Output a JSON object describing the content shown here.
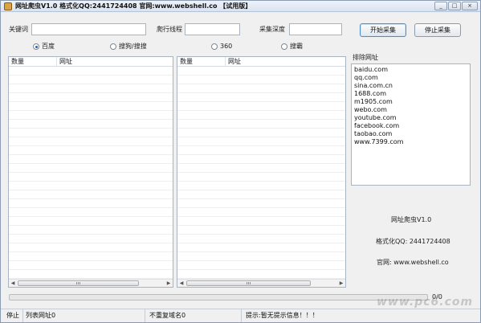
{
  "window": {
    "title": "网址爬虫V1.0 格式化QQ:2441724408 官网:www.webshell.co 【试用版】",
    "controls": [
      "_",
      "□",
      "×"
    ]
  },
  "form": {
    "keyword_label": "关键词",
    "keyword_value": "",
    "threads_label": "爬行线程",
    "threads_value": "",
    "depth_label": "采集深度",
    "depth_value": "",
    "start_button": "开始采集",
    "stop_button": "停止采集"
  },
  "engines": [
    {
      "label": "百度",
      "checked": true
    },
    {
      "label": "搜狗/搜搜",
      "checked": false
    },
    {
      "label": "360",
      "checked": false
    },
    {
      "label": "搜霸",
      "checked": false
    }
  ],
  "lists": [
    {
      "columns": [
        "数量",
        "网址"
      ],
      "rows": []
    },
    {
      "columns": [
        "数量",
        "网址"
      ],
      "rows": []
    }
  ],
  "exclude": {
    "title": "排除网址",
    "items": [
      "baidu.com",
      "qq.com",
      "sina.com.cn",
      "1688.com",
      "m1905.com",
      "webo.com",
      "youtube.com",
      "facebook.com",
      "taobao.com",
      "www.7399.com"
    ]
  },
  "about": {
    "name": "网址爬虫V1.0",
    "qq": "格式化QQ: 2441724408",
    "site": "官网: www.webshell.co"
  },
  "progress": {
    "text": "0/0",
    "fraction": 0
  },
  "status": {
    "state": "停止",
    "list_count": "列表网址0",
    "unique_domains": "不重复域名0",
    "hint": "提示:暂无提示信息！！！"
  },
  "watermark": "www.pc6.com"
}
